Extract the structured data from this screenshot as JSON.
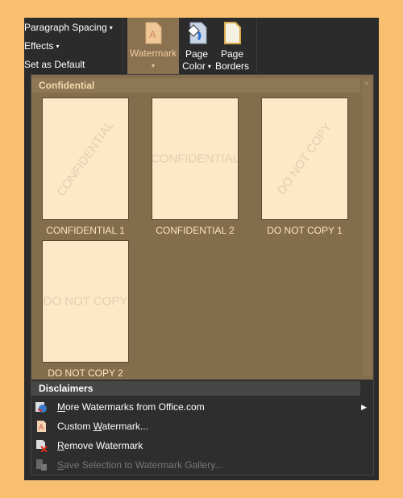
{
  "ribbon": {
    "paragraph_spacing": "Paragraph Spacing",
    "effects": "Effects",
    "set_default": "Set as Default",
    "watermark": "Watermark",
    "page_color_1": "Page",
    "page_color_2": "Color",
    "page_borders_1": "Page",
    "page_borders_2": "Borders"
  },
  "gallery": {
    "section": "Confidential",
    "items": [
      {
        "label": "CONFIDENTIAL 1",
        "text": "CONFIDENTIAL",
        "diagonal": true
      },
      {
        "label": "CONFIDENTIAL 2",
        "text": "CONFIDENTIAL",
        "diagonal": false
      },
      {
        "label": "DO NOT COPY 1",
        "text": "DO NOT COPY",
        "diagonal": true
      },
      {
        "label": "DO NOT COPY 2",
        "text": "DO NOT COPY",
        "diagonal": false
      }
    ]
  },
  "disclaimers": "Disclaimers",
  "menu": [
    {
      "key": "M",
      "rest": "ore Watermarks from Office.com",
      "icon": "globe-watermark-icon"
    },
    {
      "pre": "Custom ",
      "key": "W",
      "rest": "atermark...",
      "icon": "custom-watermark-icon"
    },
    {
      "key": "R",
      "rest": "emove Watermark",
      "icon": "remove-watermark-icon"
    },
    {
      "key": "S",
      "rest": "ave Selection to Watermark Gallery...",
      "icon": "save-selection-icon",
      "disabled": true
    }
  ],
  "colors": {
    "accent": "#8a7150",
    "gallery_bg": "#846d4c",
    "thumb": "#fde8c7",
    "page_bg": "#f9bf70"
  }
}
